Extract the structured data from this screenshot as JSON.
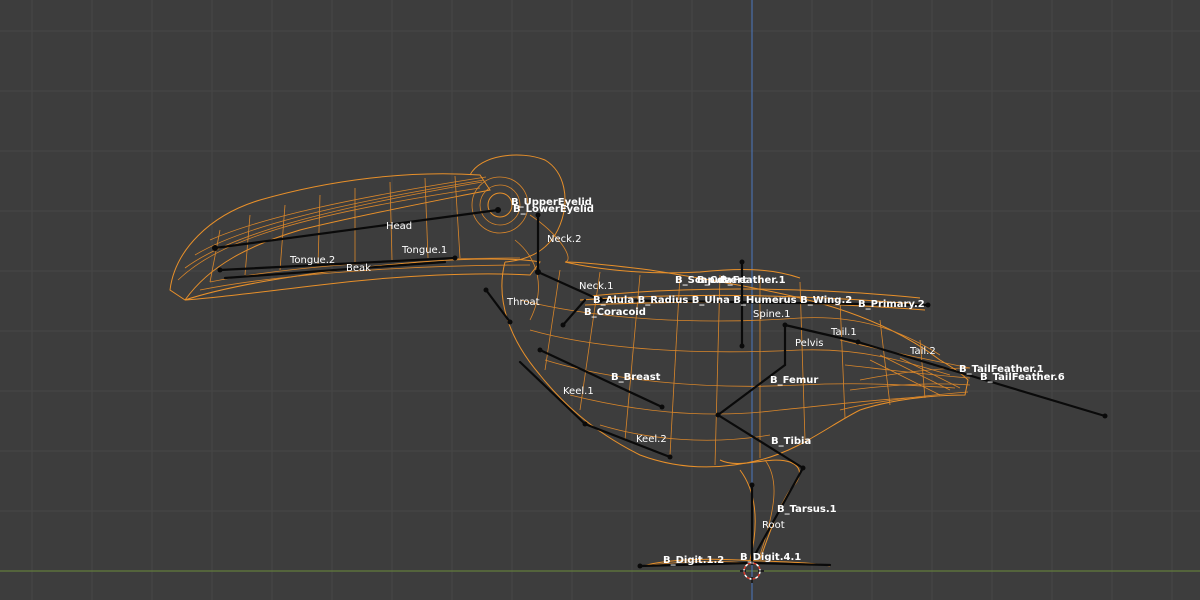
{
  "viewport": {
    "background": "#3d3d3d",
    "grid_color": "#474747",
    "wire_color": "#e8902a",
    "bone_color": "#0a0a0a",
    "axis_x_color": "#6a8a3a",
    "axis_z_color": "#4a78c0",
    "cursor_icon": "3d-cursor-icon"
  },
  "bones": {
    "head": "Head",
    "tongue_1": "Tongue.1",
    "tongue_2": "Tongue.2",
    "beak": "Beak",
    "neck_2": "Neck.2",
    "neck_1": "Neck.1",
    "throat": "Throat",
    "coracoid": "B_Coracoid",
    "breast": "B_Breast",
    "keel_1": "Keel.1",
    "keel_2": "Keel.2",
    "spine_1": "Spine.1",
    "tail_1": "Tail.1",
    "tail_2": "Tail.2",
    "pelvis": "Pelvis",
    "femur": "B_Femur",
    "tibia": "B_Tibia",
    "tarsus_1": "B_Tarsus.1",
    "root": "Root",
    "eyelid_upper": "B_UpperEyelid",
    "eyelid_lower": "B_LowerEyelid",
    "scapular": "B_Scapula",
    "covert": "B_Covert",
    "feather_1": "B_Feather.1",
    "tail_feather_1": "B_TailFeather.1",
    "tail_feather_6": "B_TailFeather.6",
    "digit": "B_Digit.1.2",
    "digit_b": "B_Digit.4.1",
    "wing_cluster": "B_Alula B_Radius B_Ulna B_Humerus B_Wing.2",
    "wing_tip": "B_Primary.2"
  }
}
